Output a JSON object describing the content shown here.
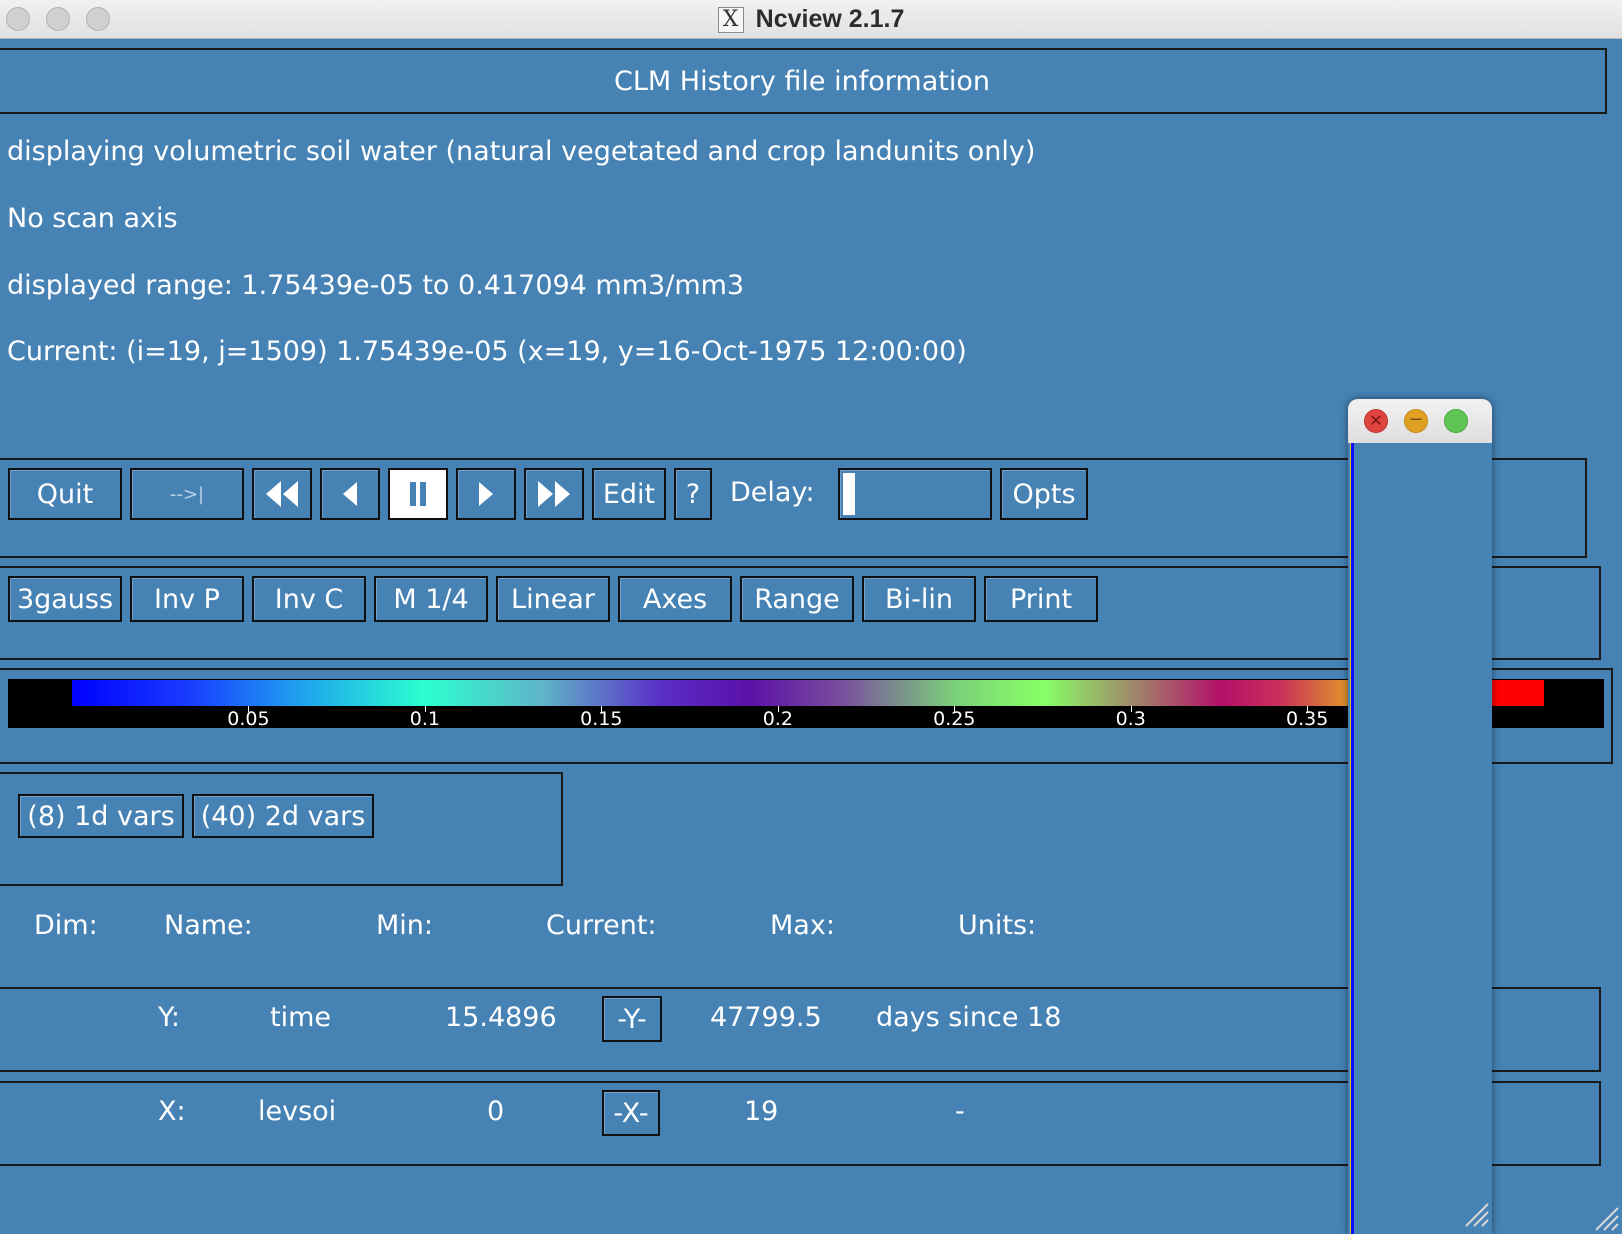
{
  "window": {
    "title": "Ncview 2.1.7",
    "x_glyph": "X"
  },
  "header": {
    "title": "CLM History file information"
  },
  "info": {
    "displaying": "displaying volumetric soil water (natural vegetated and crop landunits only)",
    "scan_axis": "No scan axis",
    "range": "displayed range: 1.75439e-05 to 0.417094 mm3/mm3",
    "current": "Current: (i=19, j=1509) 1.75439e-05 (x=19, y=16-Oct-1975 12:00:00)"
  },
  "toolbar": {
    "quit": "Quit",
    "restart": "-->|",
    "edit": "Edit",
    "help": "?",
    "delay_label": "Delay:",
    "opts": "Opts",
    "active_button": "pause",
    "delay_level": 0
  },
  "options_row": {
    "colormap": "3gauss",
    "inv_p": "Inv P",
    "inv_c": "Inv C",
    "magnify": "M 1/4",
    "transform": "Linear",
    "axes": "Axes",
    "range": "Range",
    "interp": "Bi-lin",
    "print": "Print"
  },
  "colorbar": {
    "ticks": [
      "0.05",
      "0.1",
      "0.15",
      "0.2",
      "0.25",
      "0.3",
      "0.35"
    ],
    "min": 1.75439e-05,
    "max": 0.417094
  },
  "vars": {
    "one_d": "(8) 1d vars",
    "two_d": "(40) 2d vars"
  },
  "dims": {
    "headers": {
      "dim": "Dim:",
      "name": "Name:",
      "min": "Min:",
      "current": "Current:",
      "max": "Max:",
      "units": "Units:"
    },
    "rows": [
      {
        "dim": "Y:",
        "name": "time",
        "min": "15.4896",
        "current": "-Y-",
        "max": "47799.5",
        "units": "days since 18"
      },
      {
        "dim": "X:",
        "name": "levsoi",
        "min": "0",
        "current": "-X-",
        "max": "19",
        "units": "-"
      }
    ]
  },
  "colors": {
    "background": "#4682b4",
    "border": "#1a1a1a",
    "text": "#ffffff",
    "popup_close": "#e0443e",
    "popup_min": "#dea123",
    "popup_zoom": "#61c554"
  },
  "icons": {
    "to_start": "double-left-triangle",
    "step_back": "left-triangle",
    "pause": "pause-bars",
    "step_forward": "right-triangle",
    "fast_forward": "double-right-triangle",
    "resize": "diagonal-grip"
  }
}
